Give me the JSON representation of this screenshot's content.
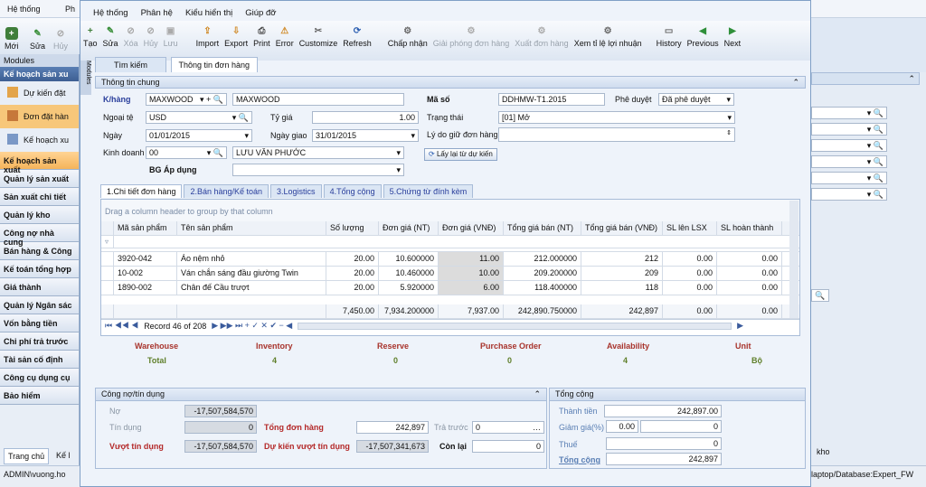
{
  "bg": {
    "menu": [
      "Hệ thống",
      "Ph"
    ],
    "toolbar": [
      "Mới",
      "Sửa",
      "Hủy"
    ],
    "modules_title": "Modules",
    "module_group": "Kế hoạch sản xu",
    "sub_items": [
      "Dự kiến đặt",
      "Đơn đặt hàn",
      "Kế hoạch xu"
    ],
    "side_items": [
      "Kế hoạch sản xuất",
      "Quản lý sản xuất",
      "Sản xuất chi tiết",
      "Quản lý kho",
      "Công nợ nhà cung",
      "Bán hàng & Công",
      "Kế toán tổng hợp",
      "Giá thành",
      "Quản lý Ngân sác",
      "Vốn bằng tiền",
      "Chi phí trả trước",
      "Tài sản cố định",
      "Công cụ dụng cụ",
      "Bảo hiểm"
    ],
    "tab_home": "Trang chủ",
    "tab_ke": "Kế l",
    "status_left": "ADMIN\\vuong.ho",
    "status_right": "laptop/Database:Expert_FW",
    "right_text": "kho",
    "vertical_modules": "Modules"
  },
  "dialog": {
    "menu": [
      "Hệ thống",
      "Phân hệ",
      "Kiểu hiển thị",
      "Giúp đỡ"
    ],
    "toolbar": [
      {
        "label": "Tạo",
        "dis": false
      },
      {
        "label": "Sửa",
        "dis": false
      },
      {
        "label": "Xóa",
        "dis": true
      },
      {
        "label": "Hủy",
        "dis": true
      },
      {
        "label": "Lưu",
        "dis": true
      },
      {
        "label": "Import",
        "dis": false
      },
      {
        "label": "Export",
        "dis": false
      },
      {
        "label": "Print",
        "dis": false
      },
      {
        "label": "Error",
        "dis": false
      },
      {
        "label": "Customize",
        "dis": false
      },
      {
        "label": "Refresh",
        "dis": false
      },
      {
        "label": "Chấp nhận",
        "dis": false
      },
      {
        "label": "Giải phóng đơn hàng",
        "dis": true
      },
      {
        "label": "Xuất đơn hàng",
        "dis": true
      },
      {
        "label": "Xem tỉ lệ lợi nhuận",
        "dis": false
      },
      {
        "label": "History",
        "dis": false
      },
      {
        "label": "Previous",
        "dis": false
      },
      {
        "label": "Next",
        "dis": false
      }
    ],
    "tabs": [
      "Tìm kiếm",
      "Thông tin đơn hàng"
    ],
    "general_title": "Thông tin chung",
    "fields": {
      "khang_label": "K/hàng",
      "khang_code": "MAXWOOD",
      "khang_name": "MAXWOOD",
      "ngoaite_label": "Ngoại tệ",
      "ngoaite": "USD",
      "tygia_label": "Tỷ giá",
      "tygia": "1.00",
      "ngay_label": "Ngày",
      "ngay": "01/01/2015",
      "ngaygiao_label": "Ngày giao",
      "ngaygiao": "31/01/2015",
      "kinhdoanh_label": "Kinh doanh",
      "kinhdoanh_code": "00",
      "kinhdoanh_name": "LƯU VĂN PHƯỚC",
      "bg_label": "BG Áp dụng",
      "maso_label": "Mã số",
      "maso": "DDHMW-T1.2015",
      "pheduyet_label": "Phê duyệt",
      "pheduyet": "Đã phê duyệt",
      "trangthai_label": "Trạng thái",
      "trangthai": "[01] Mở",
      "lydo_label": "Lý do giữ đơn hàng",
      "laylai_btn": "Lấy lại từ dự kiến"
    },
    "detail_tabs": [
      "1.Chi tiết đơn hàng",
      "2.Bán hàng/Kế toán",
      "3.Logistics",
      "4.Tổng cộng",
      "5.Chứng từ đính kèm"
    ],
    "group_hint": "Drag a column header to group by that column",
    "columns": [
      "Mã sản phẩm",
      "Tên sản phẩm",
      "Số lượng",
      "Đơn giá (NT)",
      "Đơn giá (VNĐ)",
      "Tổng giá bán (NT)",
      "Tổng giá bán (VNĐ)",
      "SL lên LSX",
      "SL hoàn thành"
    ],
    "rows": [
      [
        "3920-042",
        "Áo nệm nhỏ",
        "20.00",
        "10.600000",
        "11.00",
        "212.000000",
        "212",
        "0.00",
        "0.00"
      ],
      [
        "10-002",
        "Ván chắn sáng đầu giường Twin",
        "20.00",
        "10.460000",
        "10.00",
        "209.200000",
        "209",
        "0.00",
        "0.00"
      ],
      [
        "1890-002",
        "Chân đế Cầu trượt",
        "20.00",
        "5.920000",
        "6.00",
        "118.400000",
        "118",
        "0.00",
        "0.00"
      ]
    ],
    "totals": [
      "",
      "",
      "7,450.00",
      "7,934.200000",
      "7,937.00",
      "242,890.750000",
      "242,897",
      "0.00",
      "0.00"
    ],
    "record": "Record 46 of 208",
    "stock_headers": [
      "Warehouse",
      "Inventory",
      "Reserve",
      "Purchase Order",
      "Availability",
      "Unit"
    ],
    "stock_values": [
      "Total",
      "4",
      "0",
      "0",
      "4",
      "Bộ"
    ],
    "credit_title": "Công nợ/tín dụng",
    "credit": {
      "no_label": "Nợ",
      "no": "-17,507,584,570",
      "tindung_label": "Tín dụng",
      "tindung": "0",
      "vuot_label": "Vượt tín dụng",
      "vuot": "-17,507,584,570",
      "tongdon_label": "Tổng đơn hàng",
      "tongdon": "242,897",
      "dukien_label": "Dự kiến vượt tín dụng",
      "dukien": "-17,507,341,673",
      "tratruoc_label": "Trả trước",
      "tratruoc": "0",
      "conlai_label": "Còn lại",
      "conlai": "0"
    },
    "total_title": "Tổng cộng",
    "total": {
      "thanhtien_label": "Thành tiền",
      "thanhtien": "242,897.00",
      "giamgia_label": "Giảm giá(%)",
      "giamgia_pct": "0.00",
      "giamgia": "0",
      "thue_label": "Thuế",
      "thue": "0",
      "tongcong_label": "Tổng cộng",
      "tongcong": "242,897"
    }
  }
}
